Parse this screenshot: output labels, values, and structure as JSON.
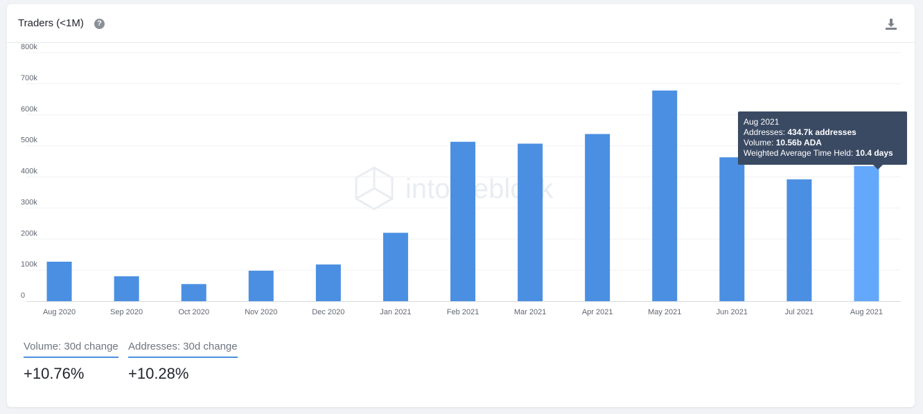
{
  "card": {
    "title": "Traders (<1M)"
  },
  "icons": {
    "help": "question-circle-icon",
    "download": "download-icon"
  },
  "colors": {
    "bar": "#4a8fe2",
    "bar_highlight": "#64a8fb",
    "tooltip_bg": "#3b4a63",
    "underline": "#4a8fdf"
  },
  "chart_data": {
    "type": "bar",
    "categories": [
      "Aug 2020",
      "Sep 2020",
      "Oct 2020",
      "Nov 2020",
      "Dec 2020",
      "Jan 2021",
      "Feb 2021",
      "Mar 2021",
      "Apr 2021",
      "May 2021",
      "Jun 2021",
      "Jul 2021",
      "Aug 2021"
    ],
    "values": [
      127000,
      80000,
      55000,
      98000,
      118000,
      220000,
      513000,
      507000,
      538000,
      678000,
      463000,
      392000,
      434700
    ],
    "ylim": [
      0,
      800000
    ],
    "yticks": [
      0,
      100000,
      200000,
      300000,
      400000,
      500000,
      600000,
      700000,
      800000
    ],
    "ytick_labels": [
      "0",
      "100k",
      "200k",
      "300k",
      "400k",
      "500k",
      "600k",
      "700k",
      "800k"
    ],
    "grid": true,
    "highlighted_index": 12,
    "watermark": "intotheblock"
  },
  "tooltip": {
    "title": "Aug 2021",
    "addresses_label": "Addresses: ",
    "addresses_value": "434.7k addresses",
    "volume_label": "Volume: ",
    "volume_value": "10.56b ADA",
    "time_label": "Weighted Average Time Held: ",
    "time_value": "10.4 days"
  },
  "stats": [
    {
      "label": "Volume: 30d change",
      "value": "+10.76%"
    },
    {
      "label": "Addresses: 30d change",
      "value": "+10.28%"
    }
  ]
}
